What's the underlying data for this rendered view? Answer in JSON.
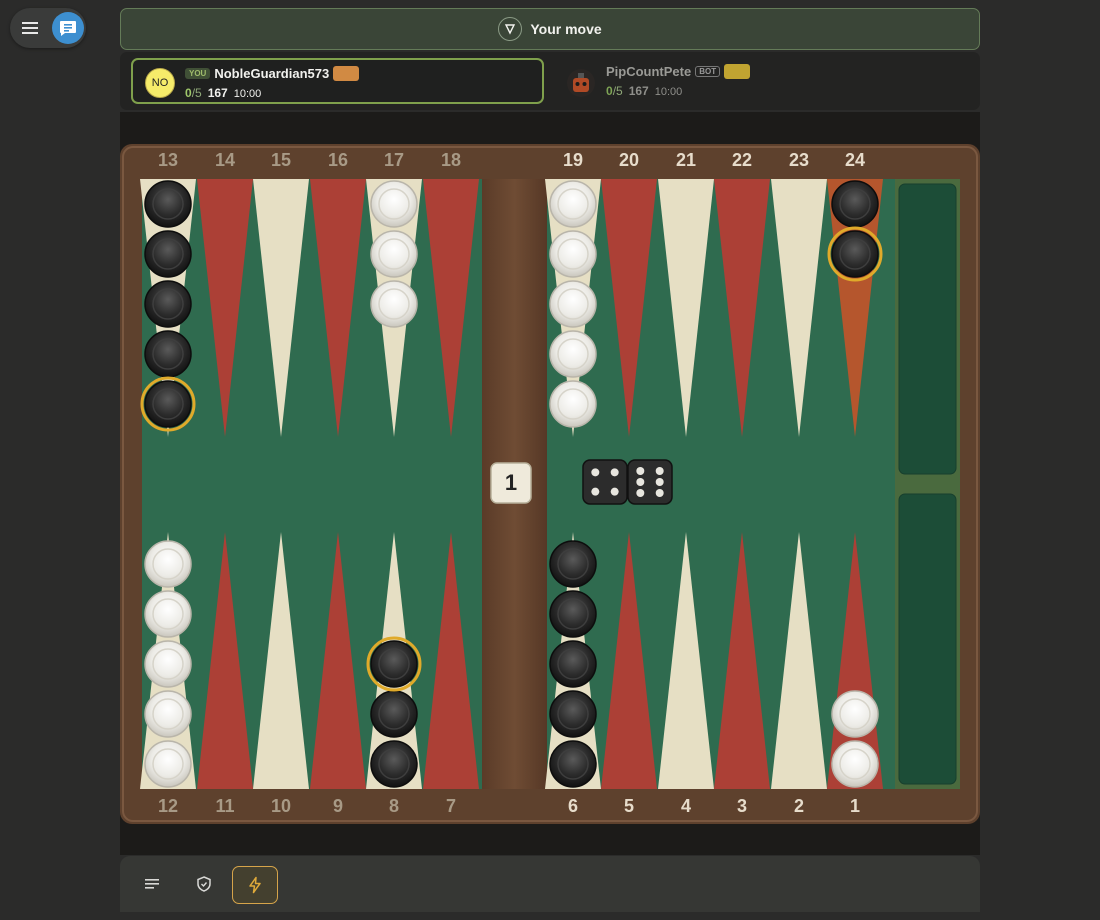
{
  "status": {
    "text": "Your move"
  },
  "players": {
    "you": {
      "tag": "YOU",
      "initials": "NO",
      "name": "NobleGuardian573",
      "score": "0",
      "match_to": "/5",
      "pips": "167",
      "clock": "10:00"
    },
    "opponent": {
      "tag": "BOT",
      "name": "PipCountPete",
      "score": "0",
      "match_to": "/5",
      "pips": "167",
      "clock": "10:00"
    }
  },
  "board": {
    "top_point_numbers": [
      "13",
      "14",
      "15",
      "16",
      "17",
      "18",
      "19",
      "20",
      "21",
      "22",
      "23",
      "24"
    ],
    "bottom_point_numbers": [
      "12",
      "11",
      "10",
      "9",
      "8",
      "7",
      "6",
      "5",
      "4",
      "3",
      "2",
      "1"
    ],
    "cube_value": "1",
    "dice": [
      4,
      6
    ],
    "checkers": [
      {
        "point": 13,
        "color": "black",
        "count": 5,
        "highlight": [
          5
        ]
      },
      {
        "point": 17,
        "color": "white",
        "count": 3,
        "highlight": []
      },
      {
        "point": 19,
        "color": "white",
        "count": 5,
        "highlight": []
      },
      {
        "point": 24,
        "color": "black",
        "count": 2,
        "highlight": [
          2
        ]
      },
      {
        "point": 12,
        "color": "white",
        "count": 5,
        "highlight": []
      },
      {
        "point": 8,
        "color": "black",
        "count": 3,
        "highlight": [
          3
        ]
      },
      {
        "point": 6,
        "color": "black",
        "count": 5,
        "highlight": []
      },
      {
        "point": 1,
        "color": "white",
        "count": 2,
        "highlight": []
      }
    ],
    "highlighted_point": 24
  },
  "colors": {
    "felt": "#2f6b4f",
    "red_point": "#ac4036",
    "cream_point": "#e6dfc4",
    "wood": "#6b4a32",
    "highlight": "#e0aa2a"
  },
  "toolbar": {
    "icons": [
      "menu-icon",
      "shield-icon",
      "bolt-icon"
    ]
  }
}
